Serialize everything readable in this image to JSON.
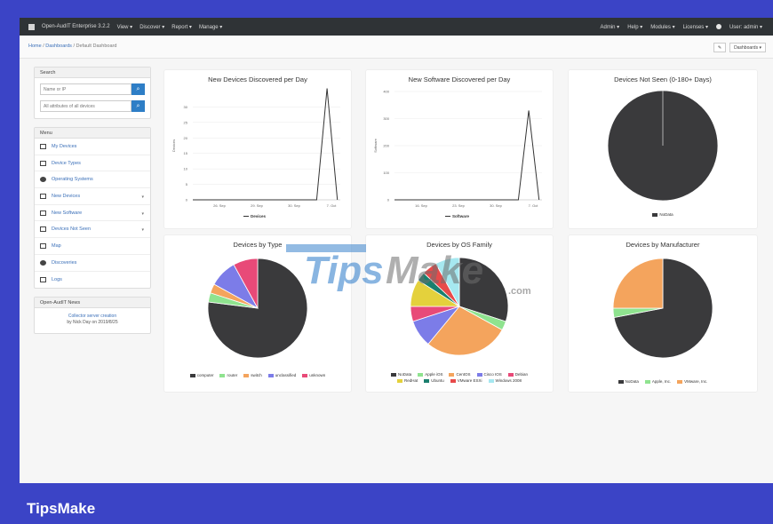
{
  "navbar": {
    "app_title": "Open-AudIT Enterprise 3.2.2",
    "menus": [
      "View",
      "Discover",
      "Report",
      "Manage"
    ],
    "right_menus": [
      "Admin",
      "Help",
      "Modules",
      "Licenses"
    ],
    "user": "User: admin"
  },
  "breadcrumb": {
    "home": "Home",
    "dashboards": "Dashboards",
    "current": "Default Dashboard"
  },
  "toolbar": {
    "dashboards_label": "Dashboards"
  },
  "search": {
    "title": "Search",
    "ip_placeholder": "Name or IP",
    "all_placeholder": "All attributes of all devices"
  },
  "menu": {
    "title": "Menu",
    "items": [
      {
        "label": "My Devices",
        "icon": "monitor-icon",
        "caret": false
      },
      {
        "label": "Device Types",
        "icon": "laptop-icon",
        "caret": false
      },
      {
        "label": "Operating Systems",
        "icon": "os-icon",
        "caret": false
      },
      {
        "label": "New Devices",
        "icon": "monitor-icon",
        "caret": true
      },
      {
        "label": "New Software",
        "icon": "bar-chart-icon",
        "caret": true
      },
      {
        "label": "Devices Not Seen",
        "icon": "list-icon",
        "caret": true
      },
      {
        "label": "Map",
        "icon": "map-icon",
        "caret": false
      },
      {
        "label": "Discoveries",
        "icon": "binoculars-icon",
        "caret": false
      },
      {
        "label": "Logs",
        "icon": "list-icon",
        "caret": false
      }
    ]
  },
  "news": {
    "title": "Open-AudIT News",
    "link": "Collector server creation",
    "by": "by Nick Day on 2019/8/25"
  },
  "brand": "TipsMake",
  "watermark": {
    "part1": "Tips",
    "part2": "Make",
    "suffix": ".com"
  },
  "chart_data": [
    {
      "type": "line",
      "title": "New Devices Discovered per Day",
      "ylabel": "Devices",
      "x": [
        "26. Sep",
        "29. Sep",
        "30. Sep",
        "7. Oct"
      ],
      "yticks": [
        0,
        5,
        10,
        15,
        20,
        25,
        30
      ],
      "series": [
        {
          "name": "Devices",
          "values": [
            0,
            0,
            0,
            0,
            0,
            0,
            0,
            0,
            0,
            0,
            0,
            0,
            0,
            36,
            0
          ]
        }
      ],
      "ylim": [
        0,
        35
      ]
    },
    {
      "type": "line",
      "title": "New Software Discovered per Day",
      "ylabel": "Software",
      "x": [
        "16. Sep",
        "23. Sep",
        "30. Sep",
        "7. Oct"
      ],
      "yticks": [
        0,
        100,
        200,
        300,
        400
      ],
      "series": [
        {
          "name": "Software",
          "values": [
            0,
            0,
            0,
            0,
            0,
            0,
            0,
            0,
            0,
            0,
            0,
            0,
            0,
            330,
            0
          ]
        }
      ],
      "ylim": [
        0,
        400
      ]
    },
    {
      "type": "pie",
      "title": "Devices Not Seen (0-180+ Days)",
      "slices": [
        {
          "label": "NoData",
          "value": 100,
          "color": "#3a3a3c"
        }
      ]
    },
    {
      "type": "pie",
      "title": "Devices by Type",
      "slices": [
        {
          "label": "computer",
          "value": 77,
          "color": "#3a3a3c"
        },
        {
          "label": "router",
          "value": 3,
          "color": "#8fe38f"
        },
        {
          "label": "switch",
          "value": 3,
          "color": "#f4a45d"
        },
        {
          "label": "unclassified",
          "value": 9,
          "color": "#7c7ce8"
        },
        {
          "label": "unknown",
          "value": 8,
          "color": "#e84a78"
        }
      ]
    },
    {
      "type": "pie",
      "title": "Devices by OS Family",
      "slices": [
        {
          "label": "NoData",
          "value": 30,
          "color": "#3a3a3c"
        },
        {
          "label": "Apple iOS",
          "value": 3,
          "color": "#8fe38f"
        },
        {
          "label": "CentOS",
          "value": 28,
          "color": "#f4a45d"
        },
        {
          "label": "Cisco IOS",
          "value": 9,
          "color": "#7c7ce8"
        },
        {
          "label": "Debian",
          "value": 5,
          "color": "#e84a78"
        },
        {
          "label": "RedHat",
          "value": 9,
          "color": "#e4d13c"
        },
        {
          "label": "Ubuntu",
          "value": 3,
          "color": "#1b7f6e"
        },
        {
          "label": "VMware ESXi",
          "value": 5,
          "color": "#e84a4a"
        },
        {
          "label": "Windows 2008",
          "value": 8,
          "color": "#a6e8f0"
        }
      ]
    },
    {
      "type": "pie",
      "title": "Devices by Manufacturer",
      "slices": [
        {
          "label": "NoData",
          "value": 72,
          "color": "#3a3a3c"
        },
        {
          "label": "Apple, Inc.",
          "value": 3,
          "color": "#8fe38f"
        },
        {
          "label": "VMware, Inc.",
          "value": 25,
          "color": "#f4a45d"
        }
      ]
    }
  ]
}
